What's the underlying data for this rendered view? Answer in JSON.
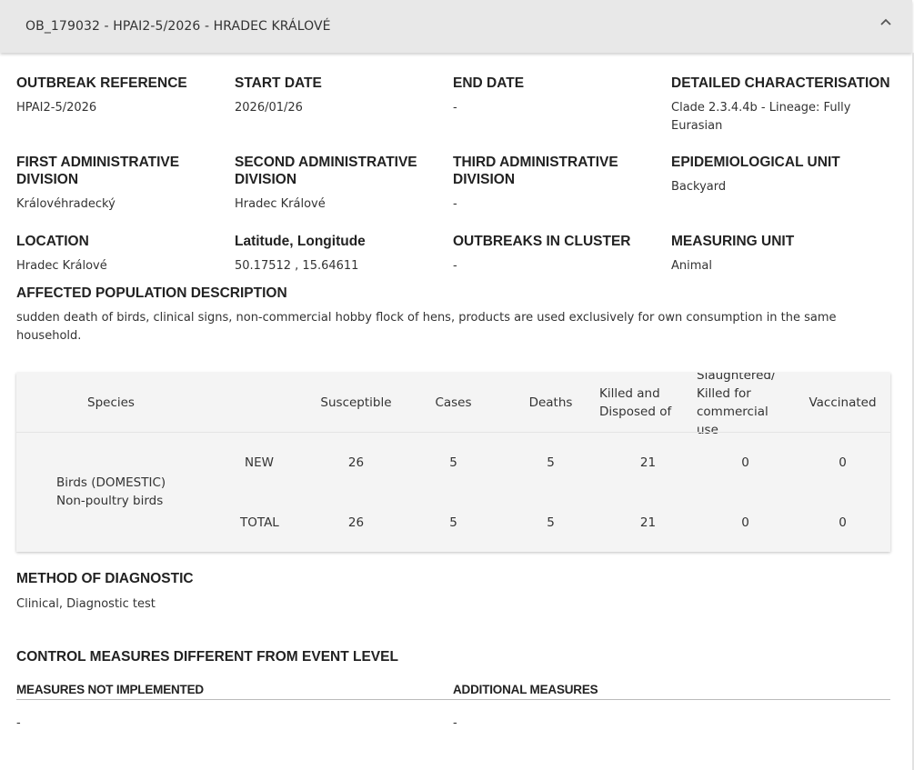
{
  "panel": {
    "title": "OB_179032 - HPAI2-5/2026 - HRADEC KRÁLOVÉ",
    "chevron_icon": "chevron-up-icon"
  },
  "fields": {
    "outbreak_reference": {
      "label": "OUTBREAK REFERENCE",
      "value": "HPAI2-5/2026"
    },
    "start_date": {
      "label": "START DATE",
      "value": "2026/01/26"
    },
    "end_date": {
      "label": "END DATE",
      "value": "-"
    },
    "detailed_characterisation": {
      "label": "DETAILED CHARACTERISATION",
      "value": "Clade 2.3.4.4b - Lineage: Fully Eurasian"
    },
    "first_admin_division": {
      "label": "FIRST ADMINISTRATIVE DIVISION",
      "value": "Královéhradecký"
    },
    "second_admin_division": {
      "label": "SECOND ADMINISTRATIVE DIVISION",
      "value": "Hradec Králové"
    },
    "third_admin_division": {
      "label": "THIRD ADMINISTRATIVE DIVISION",
      "value": "-"
    },
    "epidemiological_unit": {
      "label": "EPIDEMIOLOGICAL UNIT",
      "value": "Backyard"
    },
    "location": {
      "label": "LOCATION",
      "value": "Hradec Králové"
    },
    "lat_long": {
      "label": "Latitude, Longitude",
      "value": "50.17512 , 15.64611"
    },
    "outbreaks_in_cluster": {
      "label": "OUTBREAKS IN CLUSTER",
      "value": "-"
    },
    "measuring_unit": {
      "label": "MEASURING UNIT",
      "value": "Animal"
    }
  },
  "affected_population": {
    "label": "AFFECTED POPULATION DESCRIPTION",
    "value": "sudden death of birds, clinical signs, non-commercial hobby flock of hens, products are used exclusively for own consumption in the same household."
  },
  "table": {
    "headers": {
      "species": "Species",
      "susceptible": "Susceptible",
      "cases": "Cases",
      "deaths": "Deaths",
      "killed": "Killed and Disposed of",
      "slaughtered": "Slaughtered/ Killed for commercial use",
      "vaccinated": "Vaccinated"
    },
    "species": "Birds (DOMESTIC) Non-poultry birds",
    "rows": [
      {
        "label": "NEW",
        "susceptible": "26",
        "cases": "5",
        "deaths": "5",
        "killed": "21",
        "slaughtered": "0",
        "vaccinated": "0"
      },
      {
        "label": "TOTAL",
        "susceptible": "26",
        "cases": "5",
        "deaths": "5",
        "killed": "21",
        "slaughtered": "0",
        "vaccinated": "0"
      }
    ]
  },
  "diagnostic": {
    "label": "METHOD OF DIAGNOSTIC",
    "value": "Clinical, Diagnostic test"
  },
  "control_measures": {
    "label": "CONTROL MEASURES DIFFERENT FROM EVENT LEVEL",
    "not_implemented": {
      "label": "MEASURES NOT IMPLEMENTED",
      "value": "-"
    },
    "additional": {
      "label": "ADDITIONAL MEASURES",
      "value": "-"
    }
  }
}
